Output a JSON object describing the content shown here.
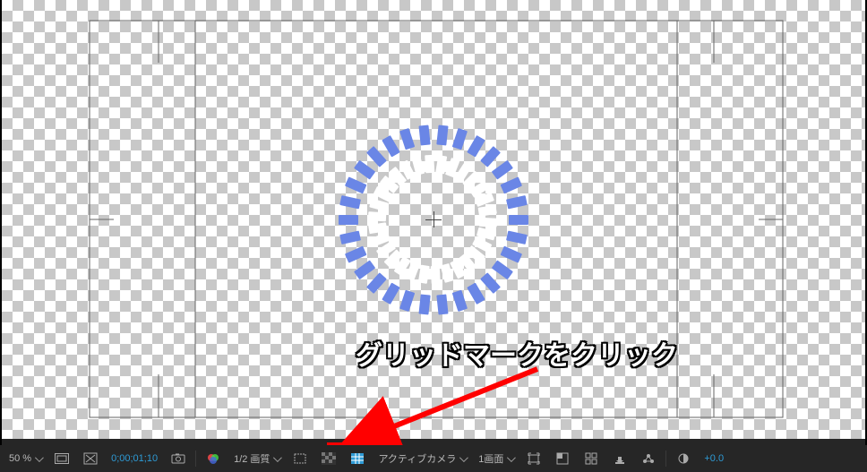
{
  "bottom_bar": {
    "zoom": "50 %",
    "timecode": "0;00;01;10",
    "resolution": "1/2 画質",
    "camera": "アクティブカメラ",
    "views": "1画面",
    "exposure": "+0.0"
  },
  "annotation": {
    "text": "グリッドマークをクリック"
  },
  "icons": {
    "fullres": "fullres-icon",
    "mask_toggle": "mask-toggle-icon",
    "snapshot": "snapshot-icon",
    "colorspace": "colorspace-icon",
    "channel": "channel-icon",
    "transparency": "transparency-grid-icon",
    "mask_mode": "mask-mode-icon",
    "roi": "region-of-interest-icon",
    "grid": "grid-guides-icon",
    "view": "view-layout-icon",
    "pixel_aspect": "pixel-aspect-icon",
    "fast_previews": "fast-previews-icon",
    "timeline_icon": "timeline-icon",
    "render_icon": "render-icon",
    "exposure_icon": "exposure-icon"
  }
}
